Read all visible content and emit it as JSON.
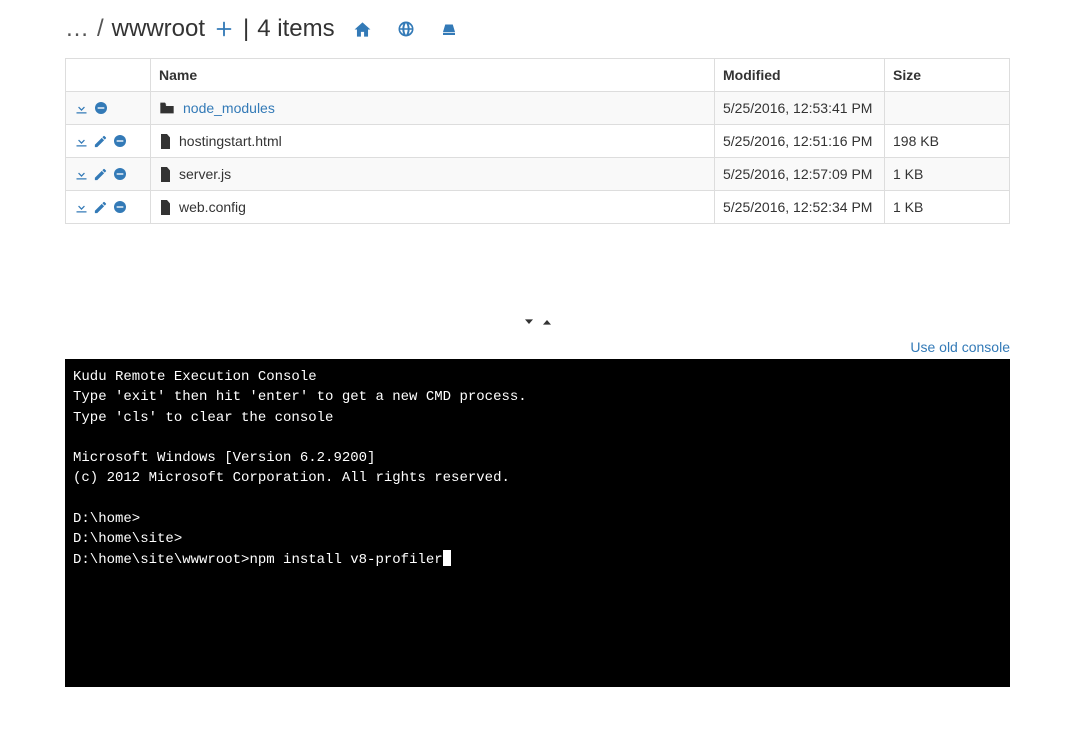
{
  "breadcrumb": {
    "ellipsis": "…",
    "sep1": "/",
    "folder": "wwwroot",
    "divider": "|",
    "count": "4 items"
  },
  "table": {
    "headers": {
      "actions": "",
      "name": "Name",
      "modified": "Modified",
      "size": "Size"
    },
    "rows": [
      {
        "type": "folder",
        "name": "node_modules",
        "modified": "5/25/2016, 12:53:41 PM",
        "size": "",
        "editable": false
      },
      {
        "type": "file",
        "name": "hostingstart.html",
        "modified": "5/25/2016, 12:51:16 PM",
        "size": "198 KB",
        "editable": true
      },
      {
        "type": "file",
        "name": "server.js",
        "modified": "5/25/2016, 12:57:09 PM",
        "size": "1 KB",
        "editable": true
      },
      {
        "type": "file",
        "name": "web.config",
        "modified": "5/25/2016, 12:52:34 PM",
        "size": "1 KB",
        "editable": true
      }
    ]
  },
  "old_console_link": "Use old console",
  "console": {
    "lines": [
      "Kudu Remote Execution Console",
      "Type 'exit' then hit 'enter' to get a new CMD process.",
      "Type 'cls' to clear the console",
      "",
      "Microsoft Windows [Version 6.2.9200]",
      "(c) 2012 Microsoft Corporation. All rights reserved.",
      "",
      "D:\\home>",
      "D:\\home\\site>"
    ],
    "prompt": "D:\\home\\site\\wwwroot>",
    "input": "npm install v8-profiler"
  }
}
